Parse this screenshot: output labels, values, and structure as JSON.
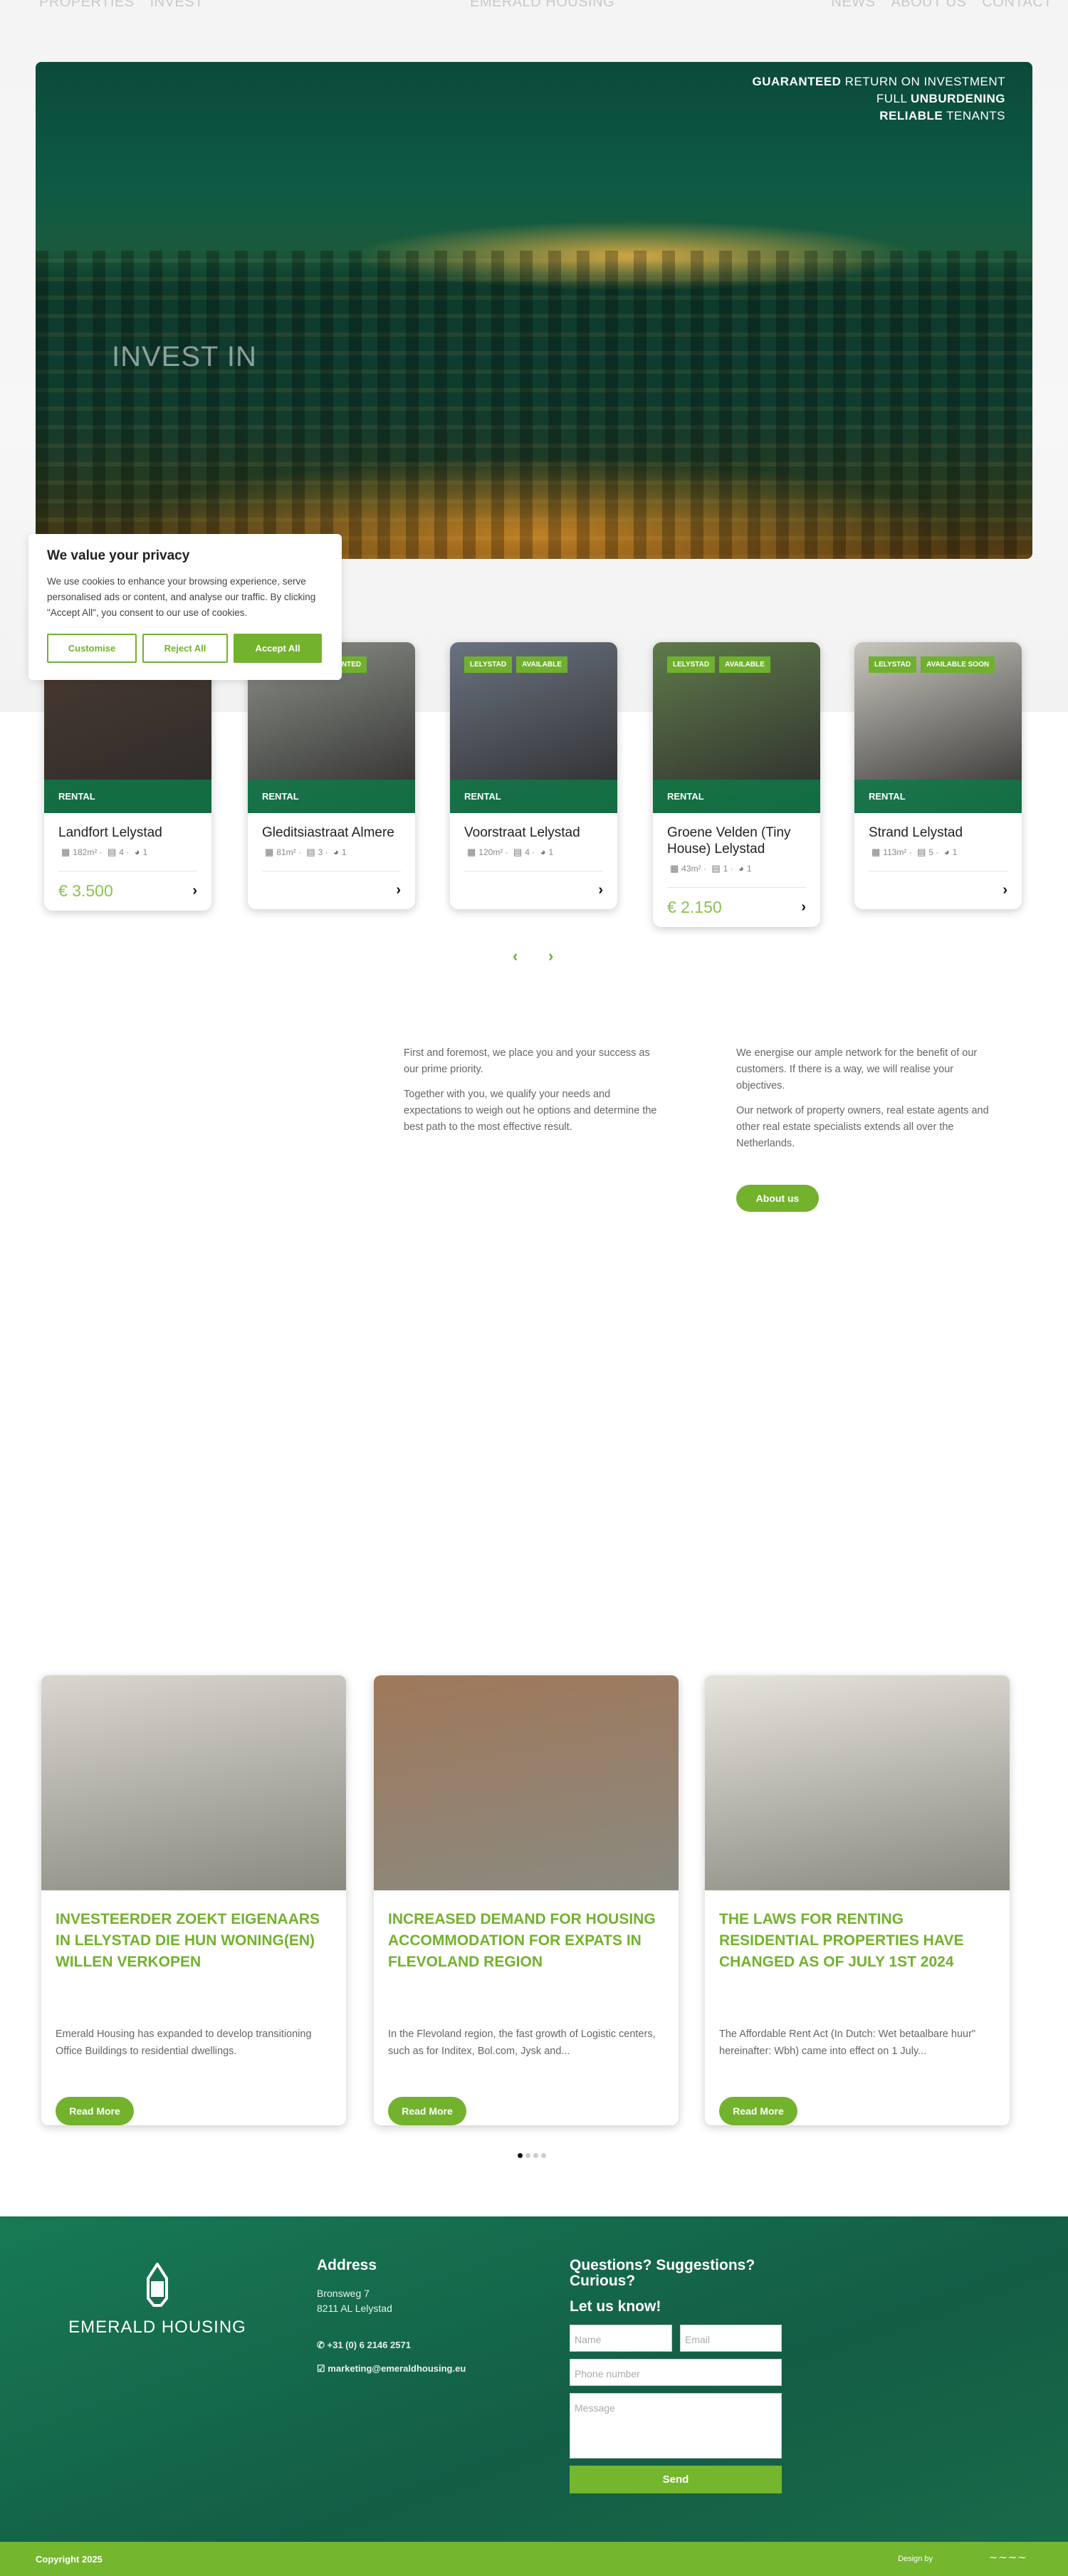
{
  "nav": {
    "left": [
      "PROPERTIES",
      "INVEST"
    ],
    "logo": "EMERALD HOUSING",
    "right": [
      "NEWS",
      "ABOUT US",
      "CONTACT"
    ]
  },
  "hero": {
    "tagline": [
      [
        "GUARANTEED",
        " RETURN ON INVESTMENT"
      ],
      [
        "FULL ",
        "UNBURDENING"
      ],
      [
        "RELIABLE",
        " TENANTS"
      ]
    ],
    "heading": "INVEST IN"
  },
  "cookie": {
    "title": "We value your privacy",
    "text": "We use cookies to enhance your browsing experience, serve personalised ads or content, and analyse our traffic. By clicking \"Accept All\", you consent to our use of cookies.",
    "customise": "Customise",
    "reject": "Reject All",
    "accept": "Accept All"
  },
  "properties": [
    {
      "name": "Landfort Lelystad",
      "type": "RENTAL",
      "badges": [],
      "area": "182m²",
      "beds": "4",
      "baths": "1",
      "price": "€ 3.500",
      "photo": "#4a3a30"
    },
    {
      "name": "Gleditsiastraat Almere",
      "type": "RENTAL",
      "badges": [
        "RENTED"
      ],
      "area": "81m²",
      "beds": "3",
      "baths": "1",
      "price": "",
      "photo": "#8c9088"
    },
    {
      "name": "Voorstraat Lelystad",
      "type": "RENTAL",
      "badges": [
        "LELYSTAD",
        "AVAILABLE"
      ],
      "area": "120m²",
      "beds": "4",
      "baths": "1",
      "price": "",
      "photo": "#6a7280"
    },
    {
      "name": "Groene Velden (Tiny House) Lelystad",
      "type": "RENTAL",
      "badges": [
        "LELYSTAD",
        "AVAILABLE"
      ],
      "area": "43m²",
      "beds": "1",
      "baths": "1",
      "price": "€ 2.150",
      "photo": "#5f7a4a"
    },
    {
      "name": "Strand Lelystad",
      "type": "RENTAL",
      "badges": [
        "LELYSTAD",
        "AVAILABLE SOON"
      ],
      "area": "113m²",
      "beds": "5",
      "baths": "1",
      "price": "",
      "photo": "#c9c6bd"
    }
  ],
  "about": {
    "col1": [
      "First and foremost, we place you and your success as our prime priority.",
      "Together with you, we qualify your needs and expectations to weigh out he options and determine the best path to the most effective result."
    ],
    "col2": [
      "We energise our ample network for the benefit of our customers. If there is a way, we will realise your objectives.",
      "Our network of property owners, real estate agents and other real estate specialists extends all over the Netherlands."
    ],
    "button": "About us"
  },
  "news": [
    {
      "title": "INVESTEERDER ZOEKT EIGENAARS IN LELYSTAD DIE HUN WONING(EN) WILLEN VERKOPEN",
      "excerpt": "Emerald Housing has expanded to develop transitioning Office Buildings to residential dwellings.",
      "button": "Read More",
      "photo": "#d9d6cf"
    },
    {
      "title": "INCREASED DEMAND FOR HOUSING ACCOMMODATION FOR EXPATS IN FLEVOLAND REGION",
      "excerpt": "In the Flevoland region, the fast growth of Logistic centers, such as for Inditex, Bol.com, Jysk and...",
      "button": "Read More",
      "photo": "#a0785a"
    },
    {
      "title": "THE LAWS FOR RENTING RESIDENTIAL PROPERTIES HAVE CHANGED AS OF JULY 1ST 2024",
      "excerpt": "The Affordable Rent Act (In Dutch: Wet betaalbare huur\" hereinafter: Wbh) came into effect on 1 July...",
      "button": "Read More",
      "photo": "#e6e3dd"
    }
  ],
  "news_pages": 4,
  "news_active": 1,
  "footer": {
    "logo": "EMERALD HOUSING",
    "address_title": "Address",
    "address": [
      "Bronsweg 7",
      "8211 AL Lelystad"
    ],
    "phone": "+31 (0) 6 2146 2571",
    "email": "marketing@emeraldhousing.eu",
    "questions": "Questions? Suggestions? Curious?",
    "let_us_know": "Let us know!",
    "form": {
      "name": "Name",
      "email": "Email",
      "phone": "Phone number",
      "message": "Message",
      "send": "Send"
    },
    "copyright": "Copyright 2025",
    "design_by": "Design by"
  },
  "colors": {
    "accent": "#72b22d",
    "footer": "#135d45"
  }
}
